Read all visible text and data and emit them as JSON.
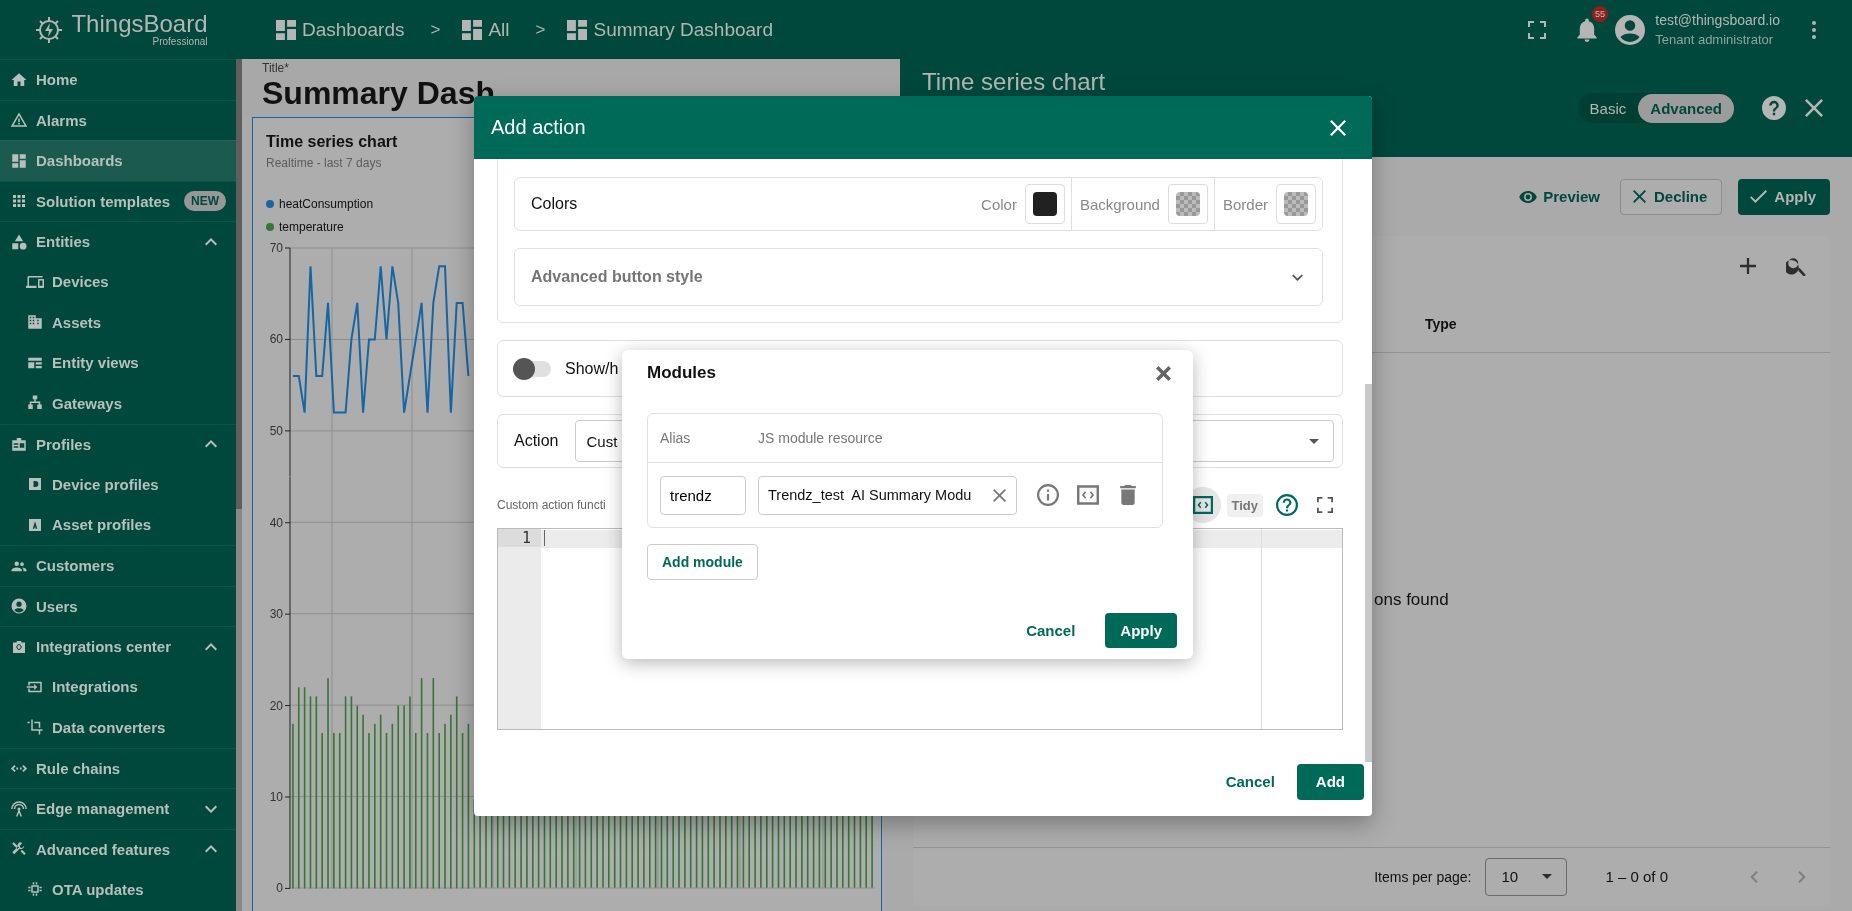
{
  "header": {
    "logo": {
      "name": "ThingsBoard",
      "edition": "Professional"
    },
    "breadcrumbs": [
      {
        "label": "Dashboards"
      },
      {
        "separator": ">",
        "label": "All"
      },
      {
        "separator": ">",
        "label": "Summary Dashboard"
      }
    ],
    "notifications": {
      "count": "55"
    },
    "user": {
      "email": "test@thingsboard.io",
      "role": "Tenant administrator"
    }
  },
  "sidebar": {
    "items": [
      {
        "label": "Home",
        "selected": false
      },
      {
        "label": "Alarms",
        "selected": false
      },
      {
        "label": "Dashboards",
        "selected": true
      },
      {
        "label": "Solution templates",
        "selected": false,
        "badge": "NEW"
      },
      {
        "label": "Entities",
        "selected": false,
        "expanded": true,
        "children": [
          {
            "label": "Devices",
            "selected": false
          },
          {
            "label": "Assets",
            "selected": false
          },
          {
            "label": "Entity views",
            "selected": false
          },
          {
            "label": "Gateways",
            "selected": false
          }
        ]
      },
      {
        "label": "Profiles",
        "selected": false,
        "expanded": true,
        "children": [
          {
            "label": "Device profiles",
            "selected": false
          },
          {
            "label": "Asset profiles",
            "selected": false
          }
        ]
      },
      {
        "label": "Customers",
        "selected": false
      },
      {
        "label": "Users",
        "selected": false
      },
      {
        "label": "Integrations center",
        "selected": false,
        "expanded": true,
        "children": [
          {
            "label": "Integrations",
            "selected": false
          },
          {
            "label": "Data converters",
            "selected": false
          }
        ]
      },
      {
        "label": "Rule chains",
        "selected": false
      },
      {
        "label": "Edge management",
        "selected": false,
        "expanded": false
      },
      {
        "label": "Advanced features",
        "selected": false,
        "expanded": true,
        "children": [
          {
            "label": "OTA updates",
            "selected": false
          }
        ]
      }
    ]
  },
  "dashboard": {
    "title_label": "Title*",
    "title": "Summary Dash",
    "widget": {
      "title": "Time series chart",
      "subtitle": "Realtime - last 7 days",
      "plots": [
        {
          "chart_data": {
            "type": "line",
            "ylim": [
              45,
              70
            ],
            "yticks": [
              50,
              60,
              70
            ],
            "grid": true,
            "series": [
              {
                "name": "heatConsumption",
                "color": "#1666a5",
                "values": [
                  56,
                  56,
                  52,
                  68,
                  56,
                  56,
                  64,
                  52,
                  52,
                  52,
                  60,
                  64,
                  52,
                  60,
                  60,
                  68,
                  60,
                  68,
                  64,
                  52,
                  56,
                  60,
                  64,
                  52,
                  64,
                  68,
                  68,
                  52,
                  64,
                  64,
                  56
                ]
              }
            ]
          }
        },
        {
          "chart_data": {
            "type": "bar",
            "ylim": [
              0,
              45
            ],
            "yticks": [
              0,
              10,
              20,
              30,
              40
            ],
            "grid": true,
            "series": [
              {
                "name": "temperature",
                "color": "#347736",
                "values": [
                  18,
                  22,
                  22,
                  21,
                  21,
                  17,
                  23,
                  17,
                  17,
                  21,
                  21,
                  20,
                  19,
                  17,
                  18,
                  19,
                  17,
                  18,
                  20,
                  20,
                  21,
                  17,
                  23,
                  17,
                  23,
                  17,
                  18,
                  19,
                  21,
                  17,
                  18
                ]
              }
            ]
          }
        }
      ]
    }
  },
  "settings_panel": {
    "title": "Time series chart",
    "modes": [
      {
        "label": "Basic",
        "selected": false
      },
      {
        "label": "Advanced",
        "selected": true
      }
    ],
    "actions": [
      {
        "kind": "preview",
        "label": "Preview"
      },
      {
        "kind": "decline",
        "label": "Decline"
      },
      {
        "kind": "apply",
        "label": "Apply"
      }
    ],
    "table": {
      "columns": [
        "Type"
      ],
      "empty_text": "ons found"
    },
    "pagination": {
      "label": "Items per page:",
      "page_size": "10",
      "range": "1 – 0 of 0"
    }
  },
  "add_action": {
    "title": "Add action",
    "colors": {
      "label": "Colors",
      "swatches": [
        {
          "label": "Color",
          "kind": "solid",
          "color": "#212121"
        },
        {
          "label": "Background",
          "kind": "checkered"
        },
        {
          "label": "Border",
          "kind": "checkered"
        }
      ]
    },
    "advanced_style": {
      "label": "Advanced button style",
      "expanded": false
    },
    "toggle": {
      "label": "Show/h",
      "on": false
    },
    "action": {
      "label": "Action",
      "value": "Cust"
    },
    "function_editor": {
      "label": "Custom action functi",
      "toolbar": [
        {
          "kind": "modules",
          "selected": true
        },
        {
          "kind": "tidy",
          "label": "Tidy",
          "selected": false
        },
        {
          "kind": "help",
          "selected": false
        },
        {
          "kind": "fullscreen",
          "selected": false
        }
      ],
      "lines": [
        "1"
      ]
    },
    "buttons": [
      {
        "kind": "text",
        "label": "Cancel"
      },
      {
        "kind": "primary",
        "label": "Add"
      }
    ]
  },
  "modules": {
    "title": "Modules",
    "columns": [
      "Alias",
      "JS module resource"
    ],
    "rows": [
      {
        "alias": "trendz",
        "resource": "Trendz_test  AI Summary Modu"
      }
    ],
    "add_label": "Add module",
    "buttons": [
      {
        "kind": "text",
        "label": "Cancel"
      },
      {
        "kind": "primary",
        "label": "Apply"
      }
    ]
  }
}
